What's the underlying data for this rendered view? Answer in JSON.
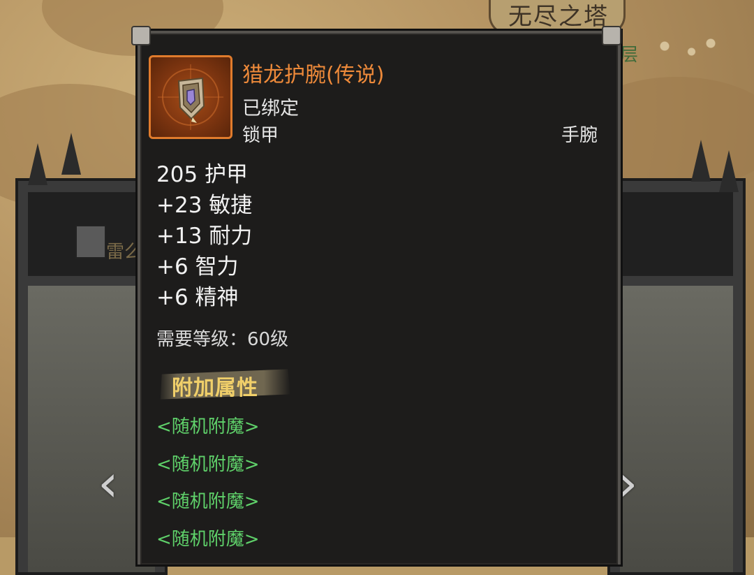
{
  "background": {
    "tower_title": "无尽之塔",
    "floor_fragment": "层",
    "left_panel_name_fragment": "雷么",
    "nav_left": "‹",
    "nav_right": "›"
  },
  "tooltip": {
    "item_name": "猎龙护腕(传说)",
    "bind_status": "已绑定",
    "armor_type": "锁甲",
    "slot": "手腕",
    "icon": "bracer-icon",
    "stats": [
      "205 护甲",
      "+23 敏捷",
      "+13 耐力",
      "+6 智力",
      "+6 精神"
    ],
    "requirement": "需要等级：60级",
    "extra_section_title": "附加属性",
    "enchants": [
      "<随机附魔>",
      "<随机附魔>",
      "<随机附魔>",
      "<随机附魔>"
    ]
  },
  "colors": {
    "legendary": "#ee8a3a",
    "enchant": "#5fd16a",
    "section_title": "#f0cf6a",
    "tooltip_bg": "#1d1c1b"
  }
}
